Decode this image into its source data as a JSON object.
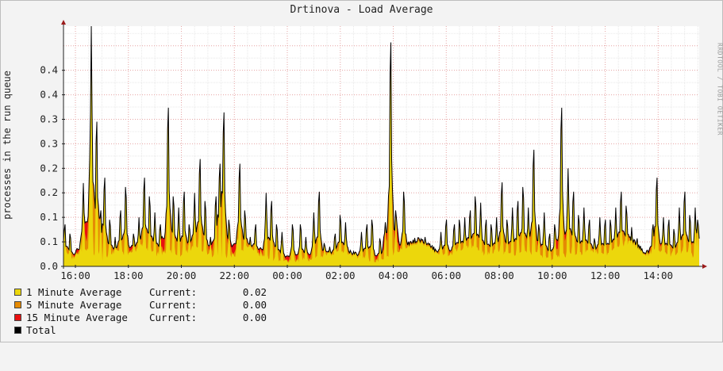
{
  "title": "Drtinova - Load Average",
  "side_text": "RRDTOOL / TOBI OETIKER",
  "chart_data": {
    "type": "area",
    "title": "Drtinova - Load Average",
    "ylabel": "processes in the run queue",
    "xlabel": "",
    "x_start_hour": 15.55,
    "x_end_hour": 39.55,
    "xlim": [
      15.55,
      39.55
    ],
    "ylim": [
      0,
      0.49
    ],
    "y_ticks": [
      {
        "value": 0.0,
        "label": "0.0"
      },
      {
        "value": 0.05,
        "label": "0.1"
      },
      {
        "value": 0.1,
        "label": "0.1"
      },
      {
        "value": 0.15,
        "label": "0.2"
      },
      {
        "value": 0.2,
        "label": "0.2"
      },
      {
        "value": 0.25,
        "label": "0.3"
      },
      {
        "value": 0.3,
        "label": "0.3"
      },
      {
        "value": 0.35,
        "label": "0.4"
      },
      {
        "value": 0.4,
        "label": "0.4"
      }
    ],
    "x_ticks": [
      {
        "value": 16,
        "label": "16:00"
      },
      {
        "value": 18,
        "label": "18:00"
      },
      {
        "value": 20,
        "label": "20:00"
      },
      {
        "value": 22,
        "label": "22:00"
      },
      {
        "value": 24,
        "label": "00:00"
      },
      {
        "value": 26,
        "label": "02:00"
      },
      {
        "value": 28,
        "label": "04:00"
      },
      {
        "value": 30,
        "label": "06:00"
      },
      {
        "value": 32,
        "label": "08:00"
      },
      {
        "value": 34,
        "label": "10:00"
      },
      {
        "value": 36,
        "label": "12:00"
      },
      {
        "value": 38,
        "label": "14:00"
      }
    ],
    "grid": true,
    "legend_position": "bottom-left",
    "series": [
      {
        "name": "1 Minute Average",
        "color": "#ecd70c",
        "current": "0.02"
      },
      {
        "name": "5 Minute Average",
        "color": "#e58a04",
        "current": "0.00"
      },
      {
        "name": "15 Minute Average",
        "color": "#e81010",
        "current": "0.00"
      },
      {
        "name": "Total",
        "color": "#000000"
      }
    ],
    "base": [
      [
        15.55,
        0.02
      ],
      [
        15.65,
        0.03
      ],
      [
        15.8,
        0.01
      ],
      [
        16.0,
        0.02
      ],
      [
        16.5,
        0.03
      ],
      [
        17.0,
        0.01
      ],
      [
        17.5,
        0.03
      ],
      [
        18.0,
        0.02
      ],
      [
        18.5,
        0.04
      ],
      [
        19.0,
        0.02
      ],
      [
        19.5,
        0.03
      ],
      [
        20.0,
        0.02
      ],
      [
        20.5,
        0.04
      ],
      [
        21.0,
        0.02
      ],
      [
        21.5,
        0.01
      ],
      [
        22.0,
        0.02
      ],
      [
        22.5,
        0.04
      ],
      [
        23.0,
        0.02
      ],
      [
        23.5,
        0.01
      ],
      [
        24.0,
        0.005
      ],
      [
        24.5,
        0.01
      ],
      [
        25.0,
        0.01
      ],
      [
        25.5,
        0.02
      ],
      [
        26.0,
        0.03
      ],
      [
        26.5,
        0.02
      ],
      [
        27.0,
        0.01
      ],
      [
        27.5,
        0.005
      ],
      [
        28.0,
        0.02
      ],
      [
        28.5,
        0.04
      ],
      [
        29.0,
        0.05
      ],
      [
        29.5,
        0.03
      ],
      [
        30.0,
        0.02
      ],
      [
        30.5,
        0.03
      ],
      [
        31.0,
        0.04
      ],
      [
        31.5,
        0.02
      ],
      [
        32.0,
        0.03
      ],
      [
        32.5,
        0.02
      ],
      [
        33.0,
        0.03
      ],
      [
        33.5,
        0.02
      ],
      [
        34.0,
        0.01
      ],
      [
        34.5,
        0.02
      ],
      [
        35.0,
        0.02
      ],
      [
        35.5,
        0.03
      ],
      [
        36.0,
        0.02
      ],
      [
        36.5,
        0.04
      ],
      [
        37.0,
        0.05
      ],
      [
        37.5,
        0.02
      ],
      [
        38.0,
        0.03
      ],
      [
        38.5,
        0.02
      ],
      [
        39.0,
        0.03
      ],
      [
        39.4,
        0.01
      ],
      [
        39.55,
        0.0
      ]
    ],
    "peaks": [
      [
        15.6,
        0.09
      ],
      [
        15.8,
        0.07
      ],
      [
        16.2,
        0.06
      ],
      [
        16.3,
        0.17
      ],
      [
        16.55,
        0.23
      ],
      [
        16.6,
        0.49
      ],
      [
        16.8,
        0.31
      ],
      [
        16.95,
        0.12
      ],
      [
        17.1,
        0.19
      ],
      [
        17.3,
        0.1
      ],
      [
        17.5,
        0.06
      ],
      [
        17.7,
        0.12
      ],
      [
        17.9,
        0.17
      ],
      [
        18.2,
        0.07
      ],
      [
        18.4,
        0.1
      ],
      [
        18.6,
        0.19
      ],
      [
        18.8,
        0.15
      ],
      [
        19.0,
        0.11
      ],
      [
        19.2,
        0.09
      ],
      [
        19.5,
        0.34
      ],
      [
        19.7,
        0.15
      ],
      [
        19.9,
        0.12
      ],
      [
        20.1,
        0.16
      ],
      [
        20.3,
        0.09
      ],
      [
        20.5,
        0.15
      ],
      [
        20.7,
        0.23
      ],
      [
        20.9,
        0.14
      ],
      [
        21.1,
        0.06
      ],
      [
        21.3,
        0.15
      ],
      [
        21.45,
        0.22
      ],
      [
        21.6,
        0.33
      ],
      [
        21.8,
        0.1
      ],
      [
        22.1,
        0.07
      ],
      [
        22.2,
        0.22
      ],
      [
        22.4,
        0.12
      ],
      [
        22.6,
        0.06
      ],
      [
        22.8,
        0.09
      ],
      [
        23.0,
        0.04
      ],
      [
        23.2,
        0.15
      ],
      [
        23.4,
        0.14
      ],
      [
        23.6,
        0.09
      ],
      [
        23.8,
        0.07
      ],
      [
        24.2,
        0.09
      ],
      [
        24.5,
        0.09
      ],
      [
        24.7,
        0.06
      ],
      [
        25.0,
        0.11
      ],
      [
        25.2,
        0.16
      ],
      [
        25.4,
        0.05
      ],
      [
        25.6,
        0.04
      ],
      [
        25.8,
        0.07
      ],
      [
        26.0,
        0.11
      ],
      [
        26.2,
        0.09
      ],
      [
        26.4,
        0.03
      ],
      [
        26.6,
        0.03
      ],
      [
        26.8,
        0.07
      ],
      [
        27.0,
        0.09
      ],
      [
        27.2,
        0.1
      ],
      [
        27.5,
        0.06
      ],
      [
        27.7,
        0.09
      ],
      [
        27.9,
        0.48
      ],
      [
        28.1,
        0.12
      ],
      [
        28.4,
        0.16
      ],
      [
        28.7,
        0.02
      ],
      [
        28.9,
        0.05
      ],
      [
        29.2,
        0.06
      ],
      [
        29.5,
        0.03
      ],
      [
        29.8,
        0.07
      ],
      [
        30.0,
        0.1
      ],
      [
        30.3,
        0.09
      ],
      [
        30.5,
        0.1
      ],
      [
        30.7,
        0.1
      ],
      [
        30.9,
        0.12
      ],
      [
        31.1,
        0.15
      ],
      [
        31.3,
        0.13
      ],
      [
        31.5,
        0.1
      ],
      [
        31.7,
        0.09
      ],
      [
        31.9,
        0.1
      ],
      [
        32.1,
        0.18
      ],
      [
        32.3,
        0.1
      ],
      [
        32.5,
        0.12
      ],
      [
        32.7,
        0.14
      ],
      [
        32.9,
        0.17
      ],
      [
        33.1,
        0.12
      ],
      [
        33.3,
        0.25
      ],
      [
        33.5,
        0.09
      ],
      [
        33.7,
        0.11
      ],
      [
        33.9,
        0.07
      ],
      [
        34.1,
        0.09
      ],
      [
        34.35,
        0.34
      ],
      [
        34.6,
        0.2
      ],
      [
        34.8,
        0.16
      ],
      [
        35.0,
        0.11
      ],
      [
        35.2,
        0.12
      ],
      [
        35.4,
        0.1
      ],
      [
        35.6,
        0.06
      ],
      [
        35.8,
        0.1
      ],
      [
        36.0,
        0.1
      ],
      [
        36.2,
        0.1
      ],
      [
        36.4,
        0.12
      ],
      [
        36.6,
        0.16
      ],
      [
        36.8,
        0.13
      ],
      [
        37.0,
        0.08
      ],
      [
        37.2,
        0.06
      ],
      [
        37.35,
        0.03
      ],
      [
        37.6,
        0.03
      ],
      [
        37.8,
        0.09
      ],
      [
        37.95,
        0.19
      ],
      [
        38.2,
        0.1
      ],
      [
        38.4,
        0.1
      ],
      [
        38.6,
        0.08
      ],
      [
        38.8,
        0.12
      ],
      [
        39.0,
        0.16
      ],
      [
        39.2,
        0.11
      ],
      [
        39.4,
        0.12
      ],
      [
        39.5,
        0.1
      ]
    ]
  }
}
